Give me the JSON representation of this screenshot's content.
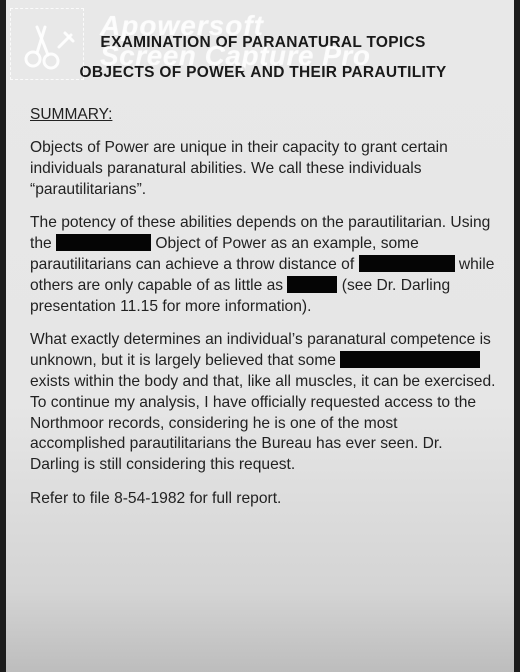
{
  "document": {
    "title_line1": "EXAMINATION OF PARANATURAL TOPICS",
    "title_line2": "OBJECTS OF POWER AND THEIR PARAUTILITY",
    "summary_label": "SUMMARY:",
    "p1": "Objects of Power are unique in their capacity to grant certain individuals paranatural abilities. We call these individuals “parautilitarians”.",
    "p2_a": "The potency of these abilities depends on the parautilitarian. Using the ",
    "p2_b": " Object of Power as an example, some parautilitarians can achieve a throw distance of ",
    "p2_c": " while others are only capable of as little as ",
    "p2_d": " (see Dr. Darling presentation 11.15 for more information).",
    "p3_a": "What exactly determines an individual’s paranatural competence is unknown, but it is largely believed that some ",
    "p3_b": " exists within the body and that, like all muscles, it can be exercised. To continue my analysis, I have officially requested access to the Northmoor records, considering he is one of the most accomplished parautilitarians the Bureau has ever seen. Dr. Darling is still considering this request.",
    "p4": "Refer to file 8-54-1982 for full report."
  },
  "watermark": {
    "line1": "Apowersoft",
    "line2": "Screen Capture Pro"
  },
  "icons": {
    "watermark_logo": "scissors-edit-icon"
  }
}
